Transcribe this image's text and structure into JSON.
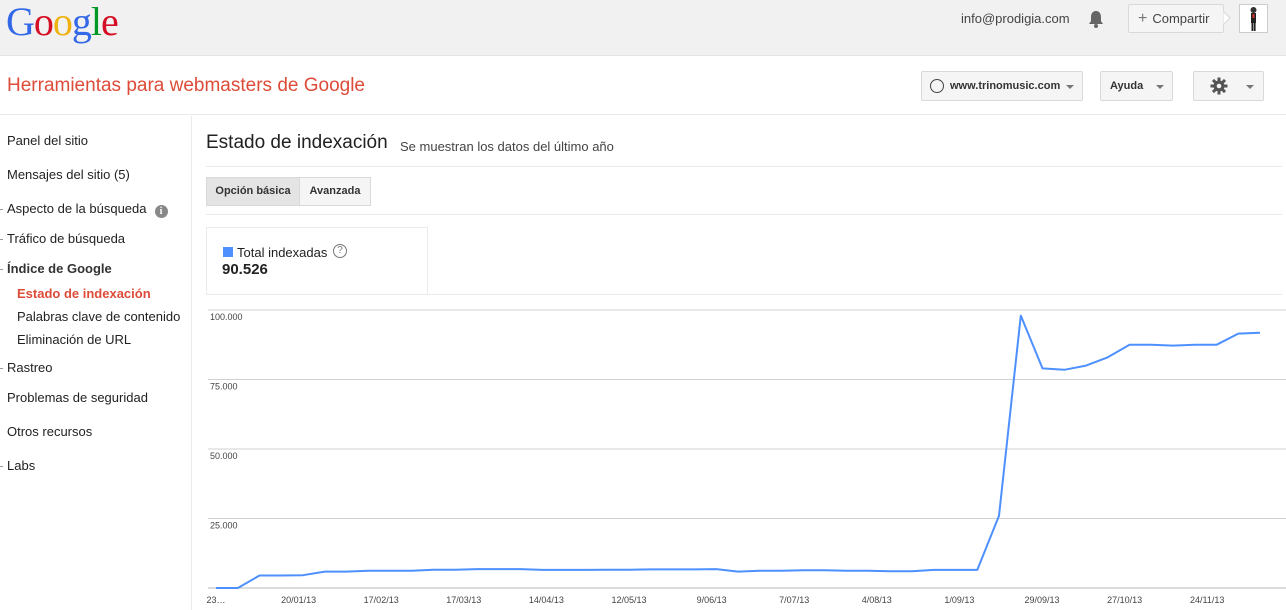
{
  "topbar": {
    "logo_letters": [
      {
        "ch": "G",
        "color": "#3369e8"
      },
      {
        "ch": "o",
        "color": "#d50f25"
      },
      {
        "ch": "o",
        "color": "#eeb211"
      },
      {
        "ch": "g",
        "color": "#3369e8"
      },
      {
        "ch": "l",
        "color": "#009925"
      },
      {
        "ch": "e",
        "color": "#d50f25"
      }
    ],
    "email": "info@prodigia.com",
    "share_label": "Compartir",
    "share_plus": "+"
  },
  "header": {
    "title": "Herramientas para webmasters de Google",
    "site": "www.trinomusic.com",
    "help_label": "Ayuda"
  },
  "sidebar": {
    "items": [
      {
        "label": "Panel del sitio"
      },
      {
        "label": "Mensajes del sitio (5)"
      },
      {
        "label": "Aspecto de la búsqueda",
        "info": "i"
      },
      {
        "label": "Tráfico de búsqueda"
      },
      {
        "label": "Índice de Google"
      },
      {
        "label": "Estado de indexación"
      },
      {
        "label": "Palabras clave de contenido"
      },
      {
        "label": "Eliminación de URL"
      },
      {
        "label": "Rastreo"
      },
      {
        "label": "Problemas de seguridad"
      },
      {
        "label": "Otros recursos"
      },
      {
        "label": "Labs"
      }
    ]
  },
  "main": {
    "title": "Estado de indexación",
    "subtitle": "Se muestran los datos del último año",
    "tabs": [
      {
        "label": "Opción básica"
      },
      {
        "label": "Avanzada"
      }
    ],
    "stat": {
      "label": "Total indexadas",
      "help": "?",
      "value": "90.526"
    }
  },
  "colors": {
    "accent": "#dd4b39",
    "series": "#4d90fe"
  },
  "chart_data": {
    "type": "line",
    "ylim": [
      0,
      100000
    ],
    "yticks": [
      {
        "value": 25000,
        "label": "25.000"
      },
      {
        "value": 50000,
        "label": "50.000"
      },
      {
        "value": 75000,
        "label": "75.000"
      },
      {
        "value": 100000,
        "label": "100.000"
      }
    ],
    "x_tick_labels": [
      "23…",
      "20/01/13",
      "17/02/13",
      "17/03/13",
      "14/04/13",
      "12/05/13",
      "9/06/13",
      "7/07/13",
      "4/08/13",
      "1/09/13",
      "29/09/13",
      "27/10/13",
      "24/11/13"
    ],
    "series": [
      {
        "values": [
          0,
          0,
          4500,
          4500,
          4600,
          5900,
          5900,
          6200,
          6200,
          6200,
          6600,
          6600,
          6800,
          6800,
          6800,
          6500,
          6500,
          6500,
          6600,
          6600,
          6700,
          6700,
          6700,
          6800,
          5900,
          6200,
          6200,
          6400,
          6400,
          6200,
          6200,
          6000,
          6000,
          6500,
          6500,
          6500,
          26000,
          98000,
          79000,
          78500,
          80000,
          83000,
          87500,
          87500,
          87200,
          87500,
          87500,
          91500,
          91800
        ]
      }
    ]
  }
}
